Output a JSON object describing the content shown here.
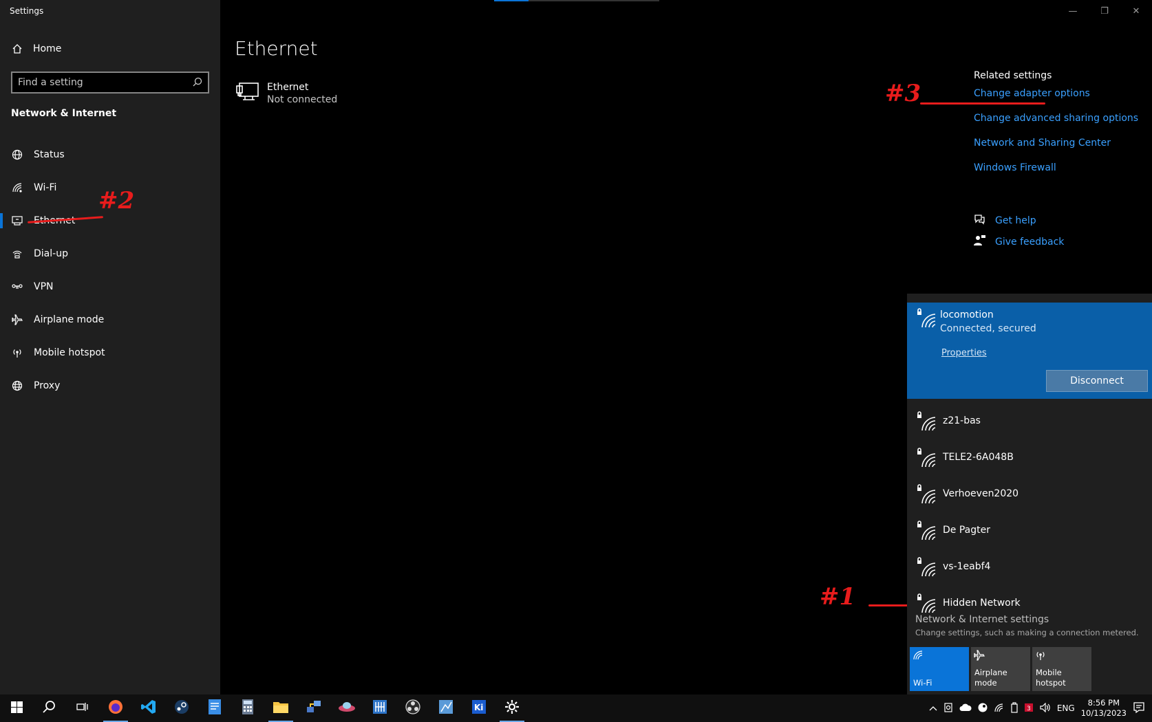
{
  "window": {
    "title": "Settings"
  },
  "sidebar": {
    "home_label": "Home",
    "search_placeholder": "Find a setting",
    "section_title": "Network & Internet",
    "items": [
      {
        "label": "Status",
        "icon": "globe-icon"
      },
      {
        "label": "Wi-Fi",
        "icon": "wifi-icon"
      },
      {
        "label": "Ethernet",
        "icon": "ethernet-icon",
        "active": true
      },
      {
        "label": "Dial-up",
        "icon": "dialup-icon"
      },
      {
        "label": "VPN",
        "icon": "vpn-icon"
      },
      {
        "label": "Airplane mode",
        "icon": "airplane-icon"
      },
      {
        "label": "Mobile hotspot",
        "icon": "hotspot-icon"
      },
      {
        "label": "Proxy",
        "icon": "proxy-icon"
      }
    ]
  },
  "main": {
    "title": "Ethernet",
    "adapter": {
      "name": "Ethernet",
      "status": "Not connected"
    }
  },
  "related": {
    "title": "Related settings",
    "links": [
      "Change adapter options",
      "Change advanced sharing options",
      "Network and Sharing Center",
      "Windows Firewall"
    ],
    "help": "Get help",
    "feedback": "Give feedback"
  },
  "annotations": {
    "one": "#1",
    "two": "#2",
    "three": "#3",
    "color": "#e81c1c"
  },
  "flyout": {
    "connected": {
      "name": "locomotion",
      "status": "Connected, secured",
      "properties": "Properties",
      "disconnect": "Disconnect"
    },
    "networks": [
      "z21-bas",
      "TELE2-6A048B",
      "Verhoeven2020",
      "De Pagter",
      "vs-1eabf4",
      "Hidden Network"
    ],
    "settings_link": "Network & Internet settings",
    "settings_sub": "Change settings, such as making a connection metered.",
    "quick_actions": [
      {
        "label": "Wi-Fi",
        "on": true
      },
      {
        "label": "Airplane mode",
        "on": false
      },
      {
        "label": "Mobile hotspot",
        "on": false
      }
    ]
  },
  "taskbar": {
    "language": "ENG",
    "time": "8:56 PM",
    "date": "10/13/2023",
    "accent": "#0a74d8"
  }
}
